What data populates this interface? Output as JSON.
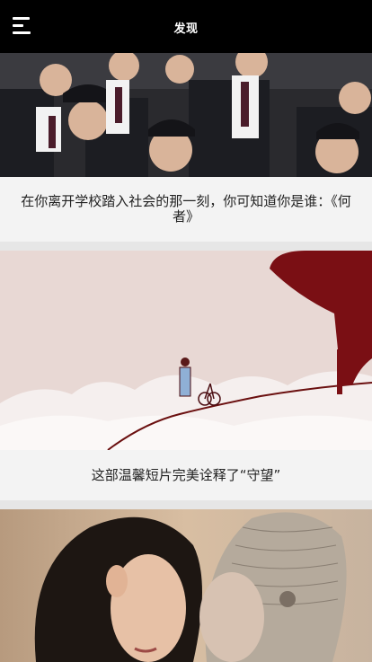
{
  "header": {
    "title": "发现",
    "menu_icon": "hamburger-menu-icon"
  },
  "articles": [
    {
      "title": "在你离开学校踏入社会的那一刻，你可知道你是谁：《何者》"
    },
    {
      "title": "这部温馨短片完美诠释了“守望”"
    },
    {
      "title": ""
    }
  ]
}
